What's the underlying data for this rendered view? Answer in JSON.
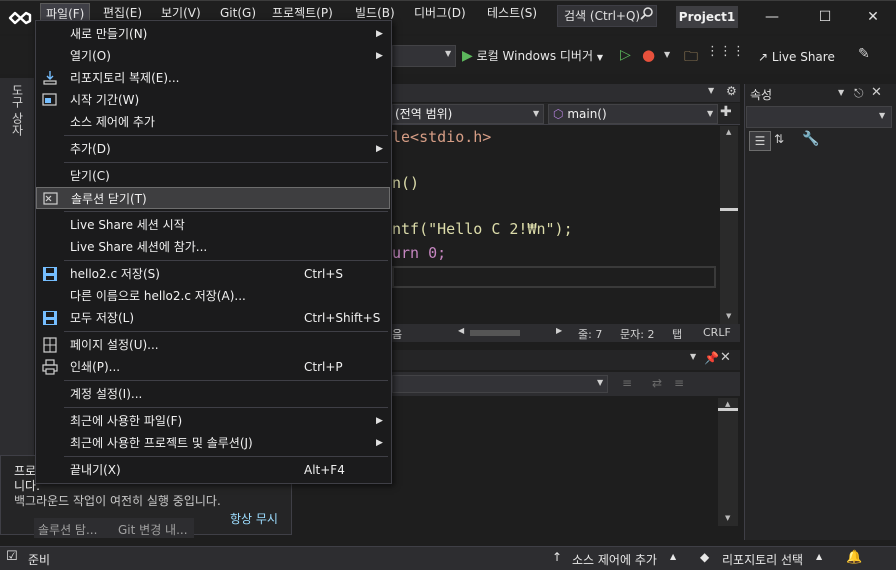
{
  "title_bar": {
    "menus": [
      "파일(F)",
      "편집(E)",
      "보기(V)",
      "Git(G)",
      "프로젝트(P)",
      "빌드(B)",
      "디버그(D)",
      "테스트(S)"
    ],
    "search_placeholder": "검색 (Ctrl+Q)",
    "project_name": "Project1"
  },
  "toolbar": {
    "run_label": "로컬 Windows 디버거",
    "live_share_label": "Live Share"
  },
  "tool_strip": {
    "label": "도구 상자"
  },
  "editor": {
    "scope": "(전역 범위)",
    "function": "main()",
    "code_lines": [
      "le<stdio.h>",
      "",
      "n()",
      "",
      "ntf(\"Hello C 2!₩n\");",
      "urn 0;"
    ],
    "status": {
      "left_text": "음",
      "line": "줄: 7",
      "col": "문자: 2",
      "tab": "탭",
      "eol": "CRLF"
    }
  },
  "properties": {
    "title": "속성"
  },
  "notification": {
    "line1": "프로",
    "line2": "니다.",
    "line3": "백그라운드 작업이 여전히 실행 중입니다.",
    "dismiss": "항상 무시"
  },
  "bottom_tabs": [
    "솔루션 탐...",
    "Git 변경 내..."
  ],
  "status_bar": {
    "ready": "준비",
    "source_control": "소스 제어에 추가",
    "repository": "리포지토리 선택"
  },
  "file_menu": {
    "items": [
      {
        "label": "새로 만들기(N)",
        "shortcut": "",
        "submenu": true,
        "icon": ""
      },
      {
        "label": "열기(O)",
        "shortcut": "",
        "submenu": true,
        "icon": ""
      },
      {
        "label": "리포지토리 복제(E)...",
        "shortcut": "",
        "submenu": false,
        "icon": "clone-icon"
      },
      {
        "label": "시작 기간(W)",
        "shortcut": "",
        "submenu": false,
        "icon": "start-window-icon"
      },
      {
        "label": "소스 제어에 추가",
        "shortcut": "",
        "submenu": false,
        "icon": ""
      },
      {
        "label": "추가(D)",
        "shortcut": "",
        "submenu": true,
        "icon": ""
      },
      {
        "label": "닫기(C)",
        "shortcut": "",
        "submenu": false,
        "icon": ""
      },
      {
        "label": "솔루션 닫기(T)",
        "shortcut": "",
        "submenu": false,
        "icon": "close-solution-icon"
      },
      {
        "label": "Live Share 세션 시작",
        "shortcut": "",
        "submenu": false,
        "icon": ""
      },
      {
        "label": "Live Share 세션에 참가...",
        "shortcut": "",
        "submenu": false,
        "icon": ""
      },
      {
        "label": "hello2.c 저장(S)",
        "shortcut": "Ctrl+S",
        "submenu": false,
        "icon": "save-icon"
      },
      {
        "label": "다른 이름으로 hello2.c 저장(A)...",
        "shortcut": "",
        "submenu": false,
        "icon": ""
      },
      {
        "label": "모두 저장(L)",
        "shortcut": "Ctrl+Shift+S",
        "submenu": false,
        "icon": "save-all-icon"
      },
      {
        "label": "페이지 설정(U)...",
        "shortcut": "",
        "submenu": false,
        "icon": "page-setup-icon"
      },
      {
        "label": "인쇄(P)...",
        "shortcut": "Ctrl+P",
        "submenu": false,
        "icon": "print-icon"
      },
      {
        "label": "계정 설정(I)...",
        "shortcut": "",
        "submenu": false,
        "icon": ""
      },
      {
        "label": "최근에 사용한 파일(F)",
        "shortcut": "",
        "submenu": true,
        "icon": ""
      },
      {
        "label": "최근에 사용한 프로젝트 및 솔루션(J)",
        "shortcut": "",
        "submenu": true,
        "icon": ""
      },
      {
        "label": "끝내기(X)",
        "shortcut": "Alt+F4",
        "submenu": false,
        "icon": ""
      }
    ]
  }
}
